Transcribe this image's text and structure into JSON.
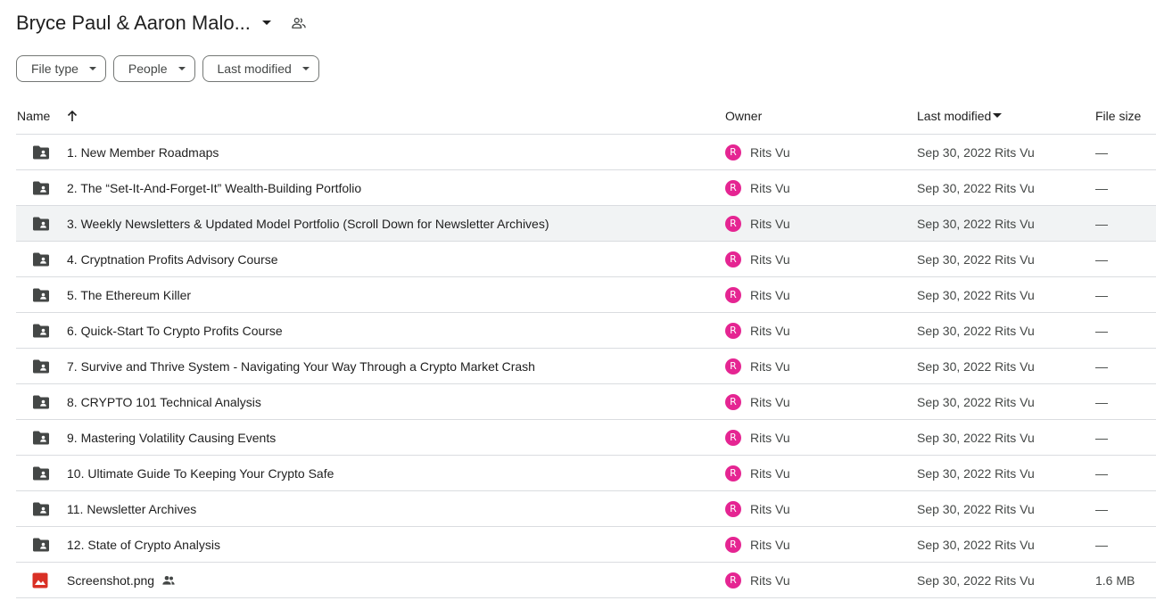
{
  "header": {
    "title": "Bryce Paul & Aaron Malo..."
  },
  "filters": [
    {
      "label": "File type"
    },
    {
      "label": "People"
    },
    {
      "label": "Last modified"
    }
  ],
  "columns": {
    "name": "Name",
    "owner": "Owner",
    "last_modified": "Last modified",
    "file_size": "File size"
  },
  "colors": {
    "avatar": "#e52592",
    "image_icon": "#d93025",
    "folder_icon": "#444746",
    "row_highlight": "#f1f3f4"
  },
  "rows": [
    {
      "type": "folder",
      "name": "1. New Member Roadmaps",
      "owner_initial": "R",
      "owner": "Rits Vu",
      "modified": "Sep 30, 2022 Rits Vu",
      "size": "—"
    },
    {
      "type": "folder",
      "name": "2. The “Set-It-And-Forget-It” Wealth-Building Portfolio",
      "owner_initial": "R",
      "owner": "Rits Vu",
      "modified": "Sep 30, 2022 Rits Vu",
      "size": "—"
    },
    {
      "type": "folder",
      "name": "3. Weekly Newsletters & Updated Model Portfolio (Scroll Down for Newsletter Archives)",
      "owner_initial": "R",
      "owner": "Rits Vu",
      "modified": "Sep 30, 2022 Rits Vu",
      "size": "—"
    },
    {
      "type": "folder",
      "name": "4. Cryptnation Profits Advisory Course",
      "owner_initial": "R",
      "owner": "Rits Vu",
      "modified": "Sep 30, 2022 Rits Vu",
      "size": "—"
    },
    {
      "type": "folder",
      "name": "5. The Ethereum Killer",
      "owner_initial": "R",
      "owner": "Rits Vu",
      "modified": "Sep 30, 2022 Rits Vu",
      "size": "—"
    },
    {
      "type": "folder",
      "name": "6. Quick-Start To Crypto Profits Course",
      "owner_initial": "R",
      "owner": "Rits Vu",
      "modified": "Sep 30, 2022 Rits Vu",
      "size": "—"
    },
    {
      "type": "folder",
      "name": "7. Survive and Thrive System - Navigating Your Way Through a Crypto Market Crash",
      "owner_initial": "R",
      "owner": "Rits Vu",
      "modified": "Sep 30, 2022 Rits Vu",
      "size": "—"
    },
    {
      "type": "folder",
      "name": "8. CRYPTO 101 Technical Analysis",
      "owner_initial": "R",
      "owner": "Rits Vu",
      "modified": "Sep 30, 2022 Rits Vu",
      "size": "—"
    },
    {
      "type": "folder",
      "name": "9. Mastering Volatility Causing Events",
      "owner_initial": "R",
      "owner": "Rits Vu",
      "modified": "Sep 30, 2022 Rits Vu",
      "size": "—"
    },
    {
      "type": "folder",
      "name": "10. Ultimate Guide To Keeping Your Crypto Safe",
      "owner_initial": "R",
      "owner": "Rits Vu",
      "modified": "Sep 30, 2022 Rits Vu",
      "size": "—"
    },
    {
      "type": "folder",
      "name": "11. Newsletter Archives",
      "owner_initial": "R",
      "owner": "Rits Vu",
      "modified": "Sep 30, 2022 Rits Vu",
      "size": "—"
    },
    {
      "type": "folder",
      "name": "12. State of Crypto Analysis",
      "owner_initial": "R",
      "owner": "Rits Vu",
      "modified": "Sep 30, 2022 Rits Vu",
      "size": "—"
    },
    {
      "type": "image",
      "shared": true,
      "name": "Screenshot.png",
      "owner_initial": "R",
      "owner": "Rits Vu",
      "modified": "Sep 30, 2022 Rits Vu",
      "size": "1.6 MB"
    }
  ]
}
